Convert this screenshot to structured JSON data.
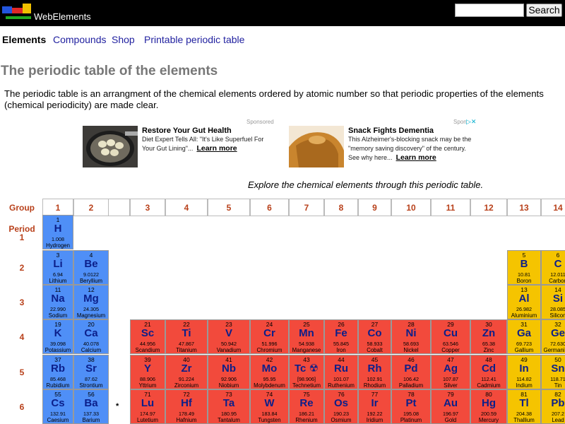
{
  "header": {
    "site_name": "WebElements",
    "search_placeholder": "",
    "search_button": "Search"
  },
  "nav": {
    "items": [
      "Elements",
      "Compounds",
      "Shop",
      "Printable periodic table"
    ]
  },
  "page": {
    "title": "The periodic table of the elements",
    "intro": "The periodic table is an arrangment of the chemical elements ordered by atomic number so that periodic properties of the elements (chemical periodicity) are made clear.",
    "explore": "Explore the chemical elements through this periodic table."
  },
  "ads": {
    "label1": "Sponsored",
    "label2": "Spon",
    "ad1": {
      "title": "Restore Your Gut Health",
      "text": "Diet Expert Tells All: \"It's Like Superfuel For Your Gut Lining\"...",
      "cta": "Learn more"
    },
    "ad2": {
      "title": "Snack Fights Dementia",
      "text": "This Alzheimer's-blocking snack may be the \"memory saving discovery\" of the century. See why here...",
      "cta": "Learn more"
    }
  },
  "table": {
    "group_label": "Group",
    "period_label": "Period",
    "groups": [
      "1",
      "2",
      "3",
      "4",
      "5",
      "6",
      "7",
      "8",
      "9",
      "10",
      "11",
      "12",
      "13",
      "14"
    ],
    "periods": [
      "1",
      "2",
      "3",
      "4",
      "5",
      "6"
    ],
    "lanthanide_marker": "*",
    "elements": [
      {
        "z": "1",
        "s": "H",
        "m": "1.008",
        "n": "Hydrogen",
        "cat": "h"
      },
      {
        "z": "3",
        "s": "Li",
        "m": "6.94",
        "n": "Lithium",
        "cat": "alkali"
      },
      {
        "z": "4",
        "s": "Be",
        "m": "9.0122",
        "n": "Beryllium",
        "cat": "alkaline"
      },
      {
        "z": "5",
        "s": "B",
        "m": "10.81",
        "n": "Boron",
        "cat": "post"
      },
      {
        "z": "6",
        "s": "C",
        "m": "12.011",
        "n": "Carbon",
        "cat": "post"
      },
      {
        "z": "11",
        "s": "Na",
        "m": "22.990",
        "n": "Sodium",
        "cat": "alkali"
      },
      {
        "z": "12",
        "s": "Mg",
        "m": "24.305",
        "n": "Magnesium",
        "cat": "alkaline"
      },
      {
        "z": "13",
        "s": "Al",
        "m": "26.982",
        "n": "Aluminium",
        "cat": "post"
      },
      {
        "z": "14",
        "s": "Si",
        "m": "28.085",
        "n": "Silicon",
        "cat": "post"
      },
      {
        "z": "19",
        "s": "K",
        "m": "39.098",
        "n": "Potassium",
        "cat": "alkali"
      },
      {
        "z": "20",
        "s": "Ca",
        "m": "40.078",
        "n": "Calcium",
        "cat": "alkaline"
      },
      {
        "z": "21",
        "s": "Sc",
        "m": "44.956",
        "n": "Scandium",
        "cat": "trans"
      },
      {
        "z": "22",
        "s": "Ti",
        "m": "47.867",
        "n": "Titanium",
        "cat": "trans"
      },
      {
        "z": "23",
        "s": "V",
        "m": "50.942",
        "n": "Vanadium",
        "cat": "trans"
      },
      {
        "z": "24",
        "s": "Cr",
        "m": "51.996",
        "n": "Chromium",
        "cat": "trans"
      },
      {
        "z": "25",
        "s": "Mn",
        "m": "54.938",
        "n": "Manganese",
        "cat": "trans"
      },
      {
        "z": "26",
        "s": "Fe",
        "m": "55.845",
        "n": "Iron",
        "cat": "trans"
      },
      {
        "z": "27",
        "s": "Co",
        "m": "58.933",
        "n": "Cobalt",
        "cat": "trans"
      },
      {
        "z": "28",
        "s": "Ni",
        "m": "58.693",
        "n": "Nickel",
        "cat": "trans"
      },
      {
        "z": "29",
        "s": "Cu",
        "m": "63.546",
        "n": "Copper",
        "cat": "trans"
      },
      {
        "z": "30",
        "s": "Zn",
        "m": "65.38",
        "n": "Zinc",
        "cat": "trans"
      },
      {
        "z": "31",
        "s": "Ga",
        "m": "69.723",
        "n": "Gallium",
        "cat": "post"
      },
      {
        "z": "32",
        "s": "Ge",
        "m": "72.630",
        "n": "Germanium",
        "cat": "post"
      },
      {
        "z": "37",
        "s": "Rb",
        "m": "85.468",
        "n": "Rubidium",
        "cat": "alkali"
      },
      {
        "z": "38",
        "s": "Sr",
        "m": "87.62",
        "n": "Strontium",
        "cat": "alkaline"
      },
      {
        "z": "39",
        "s": "Y",
        "m": "88.906",
        "n": "Yttrium",
        "cat": "trans"
      },
      {
        "z": "40",
        "s": "Zr",
        "m": "91.224",
        "n": "Zirconium",
        "cat": "trans"
      },
      {
        "z": "41",
        "s": "Nb",
        "m": "92.906",
        "n": "Niobium",
        "cat": "trans"
      },
      {
        "z": "42",
        "s": "Mo",
        "m": "95.95",
        "n": "Molybdenum",
        "cat": "trans"
      },
      {
        "z": "43",
        "s": "Tc ☢",
        "m": "[98.906]",
        "n": "Technetium",
        "cat": "trans"
      },
      {
        "z": "44",
        "s": "Ru",
        "m": "101.07",
        "n": "Ruthenium",
        "cat": "trans"
      },
      {
        "z": "45",
        "s": "Rh",
        "m": "102.91",
        "n": "Rhodium",
        "cat": "trans"
      },
      {
        "z": "46",
        "s": "Pd",
        "m": "106.42",
        "n": "Palladium",
        "cat": "trans"
      },
      {
        "z": "47",
        "s": "Ag",
        "m": "107.87",
        "n": "Silver",
        "cat": "trans"
      },
      {
        "z": "48",
        "s": "Cd",
        "m": "112.41",
        "n": "Cadmium",
        "cat": "trans"
      },
      {
        "z": "49",
        "s": "In",
        "m": "114.82",
        "n": "Indium",
        "cat": "post"
      },
      {
        "z": "50",
        "s": "Sn",
        "m": "118.71",
        "n": "Tin",
        "cat": "post"
      },
      {
        "z": "55",
        "s": "Cs",
        "m": "132.91",
        "n": "Caesium",
        "cat": "alkali"
      },
      {
        "z": "56",
        "s": "Ba",
        "m": "137.33",
        "n": "Barium",
        "cat": "alkaline"
      },
      {
        "z": "71",
        "s": "Lu",
        "m": "174.97",
        "n": "Lutetium",
        "cat": "trans"
      },
      {
        "z": "72",
        "s": "Hf",
        "m": "178.49",
        "n": "Hafnium",
        "cat": "trans"
      },
      {
        "z": "73",
        "s": "Ta",
        "m": "180.95",
        "n": "Tantalum",
        "cat": "trans"
      },
      {
        "z": "74",
        "s": "W",
        "m": "183.84",
        "n": "Tungsten",
        "cat": "trans"
      },
      {
        "z": "75",
        "s": "Re",
        "m": "186.21",
        "n": "Rhenium",
        "cat": "trans"
      },
      {
        "z": "76",
        "s": "Os",
        "m": "190.23",
        "n": "Osmium",
        "cat": "trans"
      },
      {
        "z": "77",
        "s": "Ir",
        "m": "192.22",
        "n": "Iridium",
        "cat": "trans"
      },
      {
        "z": "78",
        "s": "Pt",
        "m": "195.08",
        "n": "Platinum",
        "cat": "trans"
      },
      {
        "z": "79",
        "s": "Au",
        "m": "196.97",
        "n": "Gold",
        "cat": "trans"
      },
      {
        "z": "80",
        "s": "Hg",
        "m": "200.59",
        "n": "Mercury",
        "cat": "trans"
      },
      {
        "z": "81",
        "s": "Tl",
        "m": "204.38",
        "n": "Thallium",
        "cat": "post"
      },
      {
        "z": "82",
        "s": "Pb",
        "m": "207.2",
        "n": "Lead",
        "cat": "post"
      }
    ]
  },
  "colors": {
    "s_block": "#4f8ff7",
    "d_block": "#f24a3c",
    "p_block": "#f5c400",
    "label_color": "#b8401a"
  }
}
